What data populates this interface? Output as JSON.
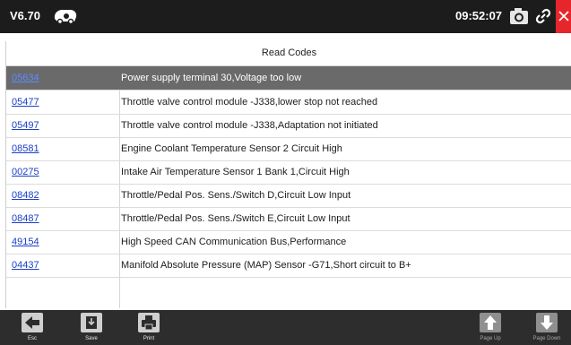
{
  "topbar": {
    "version": "V6.70",
    "logo_icon": "vw-logo-icon",
    "time": "09:52:07",
    "camera_icon": "camera-icon",
    "link_icon": "link-icon",
    "close_icon": "close-icon",
    "close_color": "#e6262b"
  },
  "table": {
    "title": "Read Codes",
    "selected_index": 0,
    "rows": [
      {
        "code": "05634",
        "description": "Power supply terminal 30,Voltage too low"
      },
      {
        "code": "05477",
        "description": "Throttle valve control module -J338,lower stop not reached"
      },
      {
        "code": "05497",
        "description": "Throttle valve control module -J338,Adaptation not initiated"
      },
      {
        "code": "08581",
        "description": "Engine Coolant Temperature Sensor 2 Circuit High"
      },
      {
        "code": "00275",
        "description": "Intake Air Temperature Sensor 1 Bank 1,Circuit High"
      },
      {
        "code": "08482",
        "description": "Throttle/Pedal Pos. Sens./Switch D,Circuit Low Input"
      },
      {
        "code": "08487",
        "description": "Throttle/Pedal Pos. Sens./Switch E,Circuit Low Input"
      },
      {
        "code": "49154",
        "description": "High Speed CAN Communication Bus,Performance"
      },
      {
        "code": "04437",
        "description": "Manifold Absolute Pressure (MAP) Sensor -G71,Short circuit to B+"
      }
    ]
  },
  "toolbar": {
    "esc": {
      "label": "Esc",
      "icon": "arrow-left-icon"
    },
    "save": {
      "label": "Save",
      "icon": "save-icon"
    },
    "print": {
      "label": "Print",
      "icon": "print-icon"
    },
    "page_up": {
      "label": "Page Up",
      "icon": "arrow-up-icon",
      "enabled": false
    },
    "page_down": {
      "label": "Page Down",
      "icon": "arrow-down-icon",
      "enabled": false
    }
  }
}
